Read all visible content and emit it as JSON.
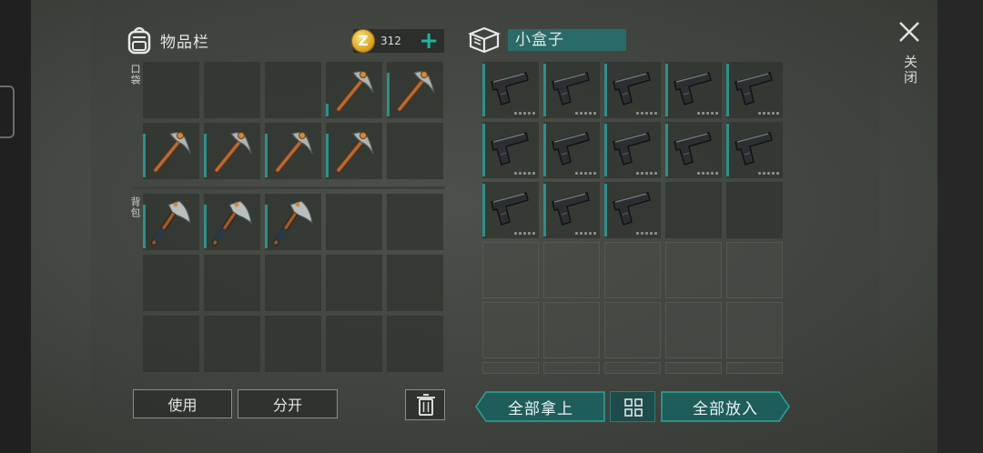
{
  "inventory": {
    "title": "物品栏",
    "coins": "312",
    "coin_symbol": "Z",
    "add_icon": "plus-icon",
    "pocket_label": "口袋",
    "backpack_label": "背包",
    "pocket_slots": [
      "empty",
      "empty",
      "empty",
      "pickaxe",
      "pickaxe",
      "pickaxe",
      "pickaxe",
      "pickaxe",
      "pickaxe",
      "empty"
    ],
    "backpack_slots": [
      "hatchet",
      "hatchet",
      "hatchet",
      "empty",
      "empty",
      "empty",
      "empty",
      "empty",
      "empty",
      "empty",
      "empty",
      "empty",
      "empty",
      "empty",
      "empty"
    ]
  },
  "container": {
    "title": "小盒子",
    "icon": "box-icon",
    "slots": [
      "pistol",
      "pistol",
      "pistol",
      "pistol",
      "pistol",
      "pistol",
      "pistol",
      "pistol",
      "pistol",
      "pistol",
      "pistol",
      "pistol",
      "pistol",
      "empty",
      "empty"
    ]
  },
  "close": {
    "label": "关闭"
  },
  "actions": {
    "use": "使用",
    "split": "分开",
    "take_all": "全部拿上",
    "put_all": "全部放入"
  },
  "colors": {
    "accent": "#2f8f89",
    "coin": "#d9a325",
    "box_title_bg": "#2a6b69"
  }
}
